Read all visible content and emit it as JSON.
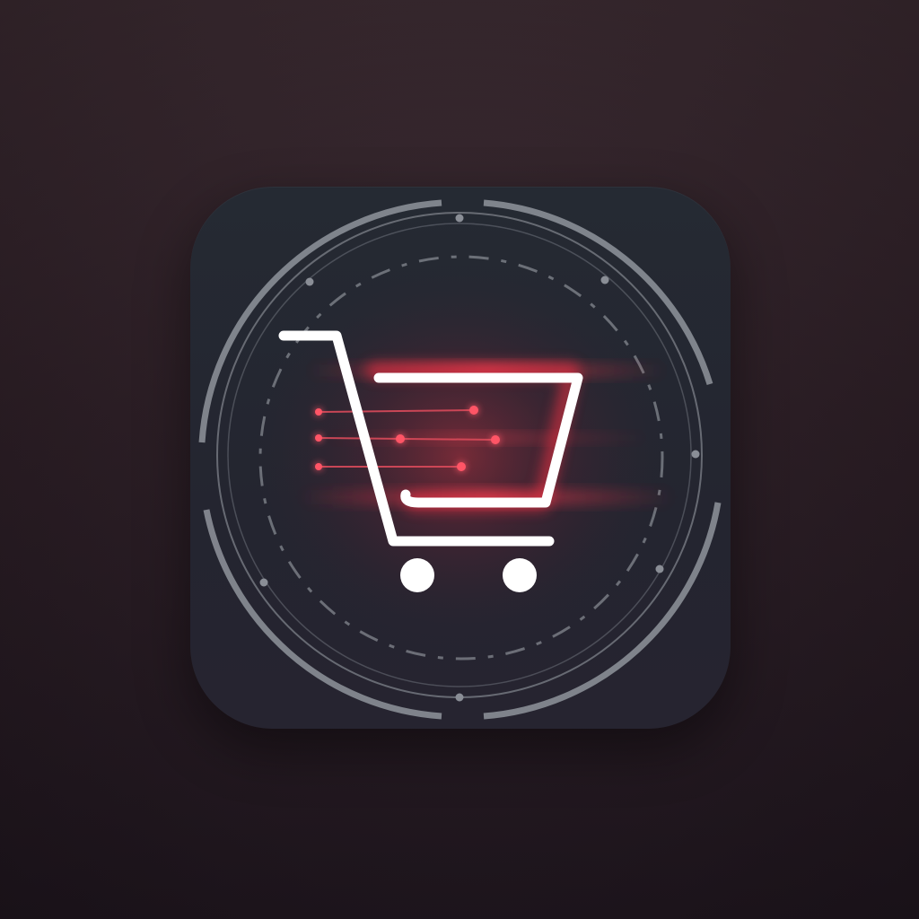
{
  "icon": {
    "semantic_name": "shopping-cart-icon",
    "frame": "circular-hud-ring-icon",
    "speed_lines": "speed-lines-icon"
  },
  "colors": {
    "background_top": "#3b2a31",
    "background_bottom": "#211720",
    "tile": "#252a33",
    "ring": "#8a8e96",
    "cart_stroke": "#ffffff",
    "glow": "#ff3344"
  }
}
